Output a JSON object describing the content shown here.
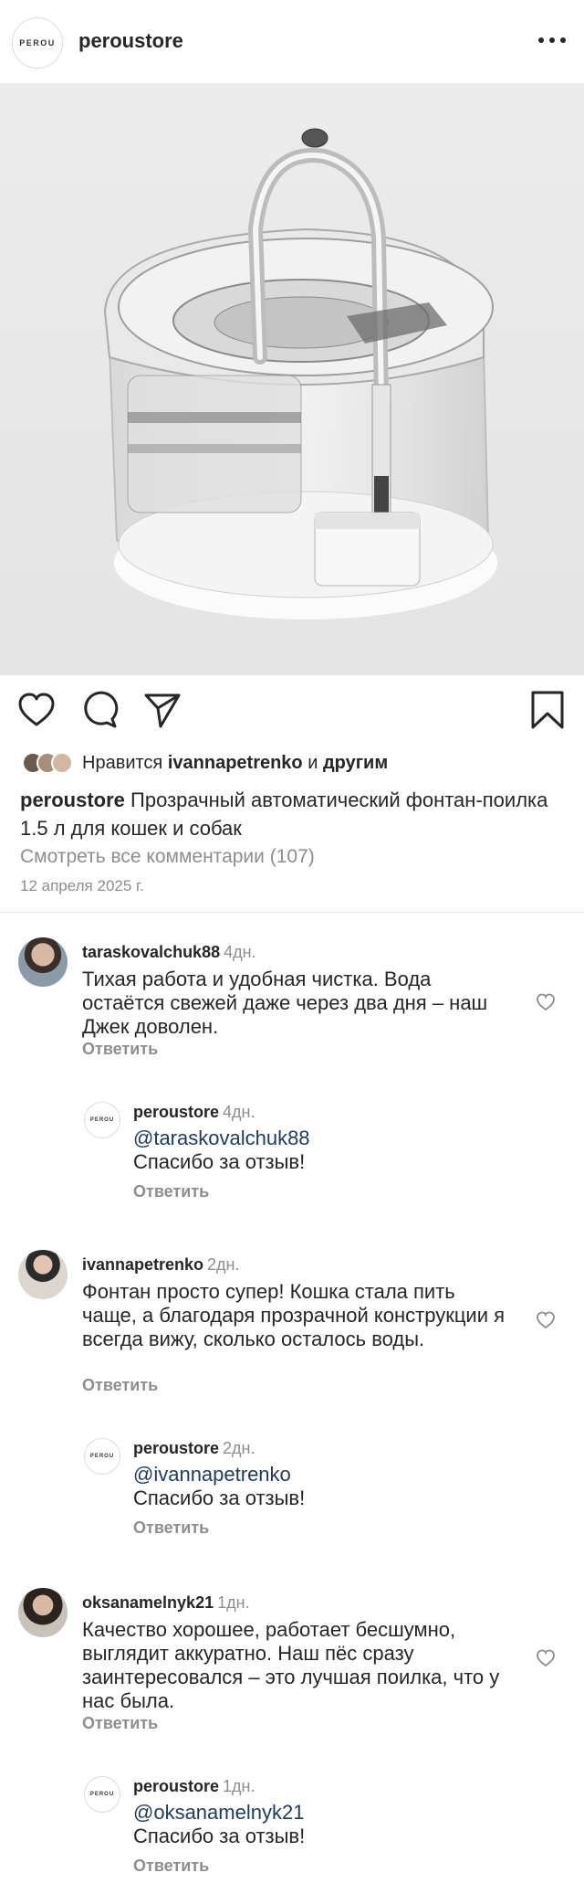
{
  "header": {
    "logo_text": "PEROU",
    "username": "peroustore",
    "more_icon": "more-horizontal-icon"
  },
  "actions": {
    "icons": [
      "heart-icon",
      "comment-icon",
      "share-icon",
      "bookmark-icon"
    ]
  },
  "likes": {
    "prefix": "Нравится",
    "user": "ivannapetrenko",
    "middle": "и",
    "suffix": "другим"
  },
  "caption": {
    "username": "peroustore",
    "text": "Прозрачный автоматический фонтан-поилка 1.5 л для кошек и собак"
  },
  "view_all_comments": "Смотреть все комментарии (107)",
  "post_date": "12 апреля 2025 г.",
  "comments": [
    {
      "username": "taraskovalchuk88",
      "time": "4дн.",
      "text": "Тихая работа и удобная чистка. Вода остаётся свежей даже через два дня – наш Джек доволен.",
      "reply_label": "Ответить",
      "reply": {
        "logo_text": "PEROU",
        "username": "peroustore",
        "time": "4дн.",
        "mention": "@taraskovalchuk88",
        "text": "Спасибо за отзыв!",
        "reply_label": "Ответить"
      }
    },
    {
      "username": "ivannapetrenko",
      "time": "2дн.",
      "text": "Фонтан просто супер! Кошка стала пить чаще, а благодаря прозрачной конструкции я всегда вижу, сколько осталось воды.",
      "reply_label": "Ответить",
      "reply": {
        "logo_text": "PEROU",
        "username": "peroustore",
        "time": "2дн.",
        "mention": "@ivannapetrenko",
        "text": "Спасибо за отзыв!",
        "reply_label": "Ответить"
      }
    },
    {
      "username": "oksanamelnyk21",
      "time": "1дн.",
      "text": "Качество хорошее, работает бесшумно, выглядит аккуратно. Наш пёс сразу заинтересовался – это лучшая поилка, что у нас была.",
      "reply_label": "Ответить",
      "reply": {
        "logo_text": "PEROU",
        "username": "peroustore",
        "time": "1дн.",
        "mention": "@oksanamelnyk21",
        "text": "Спасибо за отзыв!",
        "reply_label": "Ответить"
      }
    }
  ]
}
